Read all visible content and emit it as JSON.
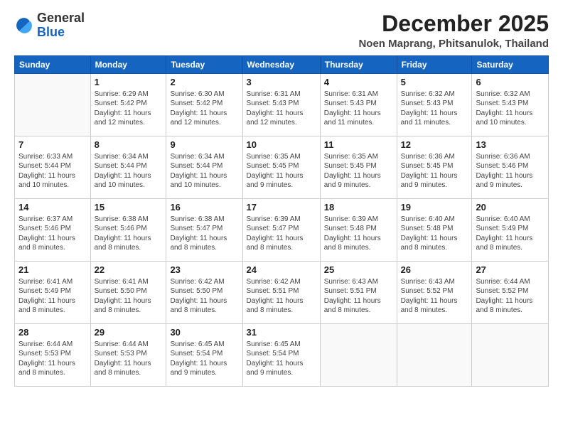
{
  "logo": {
    "general": "General",
    "blue": "Blue"
  },
  "title": "December 2025",
  "location": "Noen Maprang, Phitsanulok, Thailand",
  "days_of_week": [
    "Sunday",
    "Monday",
    "Tuesday",
    "Wednesday",
    "Thursday",
    "Friday",
    "Saturday"
  ],
  "weeks": [
    [
      {
        "day": "",
        "sunrise": "",
        "sunset": "",
        "daylight": ""
      },
      {
        "day": "1",
        "sunrise": "Sunrise: 6:29 AM",
        "sunset": "Sunset: 5:42 PM",
        "daylight": "Daylight: 11 hours and 12 minutes."
      },
      {
        "day": "2",
        "sunrise": "Sunrise: 6:30 AM",
        "sunset": "Sunset: 5:42 PM",
        "daylight": "Daylight: 11 hours and 12 minutes."
      },
      {
        "day": "3",
        "sunrise": "Sunrise: 6:31 AM",
        "sunset": "Sunset: 5:43 PM",
        "daylight": "Daylight: 11 hours and 12 minutes."
      },
      {
        "day": "4",
        "sunrise": "Sunrise: 6:31 AM",
        "sunset": "Sunset: 5:43 PM",
        "daylight": "Daylight: 11 hours and 11 minutes."
      },
      {
        "day": "5",
        "sunrise": "Sunrise: 6:32 AM",
        "sunset": "Sunset: 5:43 PM",
        "daylight": "Daylight: 11 hours and 11 minutes."
      },
      {
        "day": "6",
        "sunrise": "Sunrise: 6:32 AM",
        "sunset": "Sunset: 5:43 PM",
        "daylight": "Daylight: 11 hours and 10 minutes."
      }
    ],
    [
      {
        "day": "7",
        "sunrise": "Sunrise: 6:33 AM",
        "sunset": "Sunset: 5:44 PM",
        "daylight": "Daylight: 11 hours and 10 minutes."
      },
      {
        "day": "8",
        "sunrise": "Sunrise: 6:34 AM",
        "sunset": "Sunset: 5:44 PM",
        "daylight": "Daylight: 11 hours and 10 minutes."
      },
      {
        "day": "9",
        "sunrise": "Sunrise: 6:34 AM",
        "sunset": "Sunset: 5:44 PM",
        "daylight": "Daylight: 11 hours and 10 minutes."
      },
      {
        "day": "10",
        "sunrise": "Sunrise: 6:35 AM",
        "sunset": "Sunset: 5:45 PM",
        "daylight": "Daylight: 11 hours and 9 minutes."
      },
      {
        "day": "11",
        "sunrise": "Sunrise: 6:35 AM",
        "sunset": "Sunset: 5:45 PM",
        "daylight": "Daylight: 11 hours and 9 minutes."
      },
      {
        "day": "12",
        "sunrise": "Sunrise: 6:36 AM",
        "sunset": "Sunset: 5:45 PM",
        "daylight": "Daylight: 11 hours and 9 minutes."
      },
      {
        "day": "13",
        "sunrise": "Sunrise: 6:36 AM",
        "sunset": "Sunset: 5:46 PM",
        "daylight": "Daylight: 11 hours and 9 minutes."
      }
    ],
    [
      {
        "day": "14",
        "sunrise": "Sunrise: 6:37 AM",
        "sunset": "Sunset: 5:46 PM",
        "daylight": "Daylight: 11 hours and 8 minutes."
      },
      {
        "day": "15",
        "sunrise": "Sunrise: 6:38 AM",
        "sunset": "Sunset: 5:46 PM",
        "daylight": "Daylight: 11 hours and 8 minutes."
      },
      {
        "day": "16",
        "sunrise": "Sunrise: 6:38 AM",
        "sunset": "Sunset: 5:47 PM",
        "daylight": "Daylight: 11 hours and 8 minutes."
      },
      {
        "day": "17",
        "sunrise": "Sunrise: 6:39 AM",
        "sunset": "Sunset: 5:47 PM",
        "daylight": "Daylight: 11 hours and 8 minutes."
      },
      {
        "day": "18",
        "sunrise": "Sunrise: 6:39 AM",
        "sunset": "Sunset: 5:48 PM",
        "daylight": "Daylight: 11 hours and 8 minutes."
      },
      {
        "day": "19",
        "sunrise": "Sunrise: 6:40 AM",
        "sunset": "Sunset: 5:48 PM",
        "daylight": "Daylight: 11 hours and 8 minutes."
      },
      {
        "day": "20",
        "sunrise": "Sunrise: 6:40 AM",
        "sunset": "Sunset: 5:49 PM",
        "daylight": "Daylight: 11 hours and 8 minutes."
      }
    ],
    [
      {
        "day": "21",
        "sunrise": "Sunrise: 6:41 AM",
        "sunset": "Sunset: 5:49 PM",
        "daylight": "Daylight: 11 hours and 8 minutes."
      },
      {
        "day": "22",
        "sunrise": "Sunrise: 6:41 AM",
        "sunset": "Sunset: 5:50 PM",
        "daylight": "Daylight: 11 hours and 8 minutes."
      },
      {
        "day": "23",
        "sunrise": "Sunrise: 6:42 AM",
        "sunset": "Sunset: 5:50 PM",
        "daylight": "Daylight: 11 hours and 8 minutes."
      },
      {
        "day": "24",
        "sunrise": "Sunrise: 6:42 AM",
        "sunset": "Sunset: 5:51 PM",
        "daylight": "Daylight: 11 hours and 8 minutes."
      },
      {
        "day": "25",
        "sunrise": "Sunrise: 6:43 AM",
        "sunset": "Sunset: 5:51 PM",
        "daylight": "Daylight: 11 hours and 8 minutes."
      },
      {
        "day": "26",
        "sunrise": "Sunrise: 6:43 AM",
        "sunset": "Sunset: 5:52 PM",
        "daylight": "Daylight: 11 hours and 8 minutes."
      },
      {
        "day": "27",
        "sunrise": "Sunrise: 6:44 AM",
        "sunset": "Sunset: 5:52 PM",
        "daylight": "Daylight: 11 hours and 8 minutes."
      }
    ],
    [
      {
        "day": "28",
        "sunrise": "Sunrise: 6:44 AM",
        "sunset": "Sunset: 5:53 PM",
        "daylight": "Daylight: 11 hours and 8 minutes."
      },
      {
        "day": "29",
        "sunrise": "Sunrise: 6:44 AM",
        "sunset": "Sunset: 5:53 PM",
        "daylight": "Daylight: 11 hours and 8 minutes."
      },
      {
        "day": "30",
        "sunrise": "Sunrise: 6:45 AM",
        "sunset": "Sunset: 5:54 PM",
        "daylight": "Daylight: 11 hours and 9 minutes."
      },
      {
        "day": "31",
        "sunrise": "Sunrise: 6:45 AM",
        "sunset": "Sunset: 5:54 PM",
        "daylight": "Daylight: 11 hours and 9 minutes."
      },
      {
        "day": "",
        "sunrise": "",
        "sunset": "",
        "daylight": ""
      },
      {
        "day": "",
        "sunrise": "",
        "sunset": "",
        "daylight": ""
      },
      {
        "day": "",
        "sunrise": "",
        "sunset": "",
        "daylight": ""
      }
    ]
  ]
}
